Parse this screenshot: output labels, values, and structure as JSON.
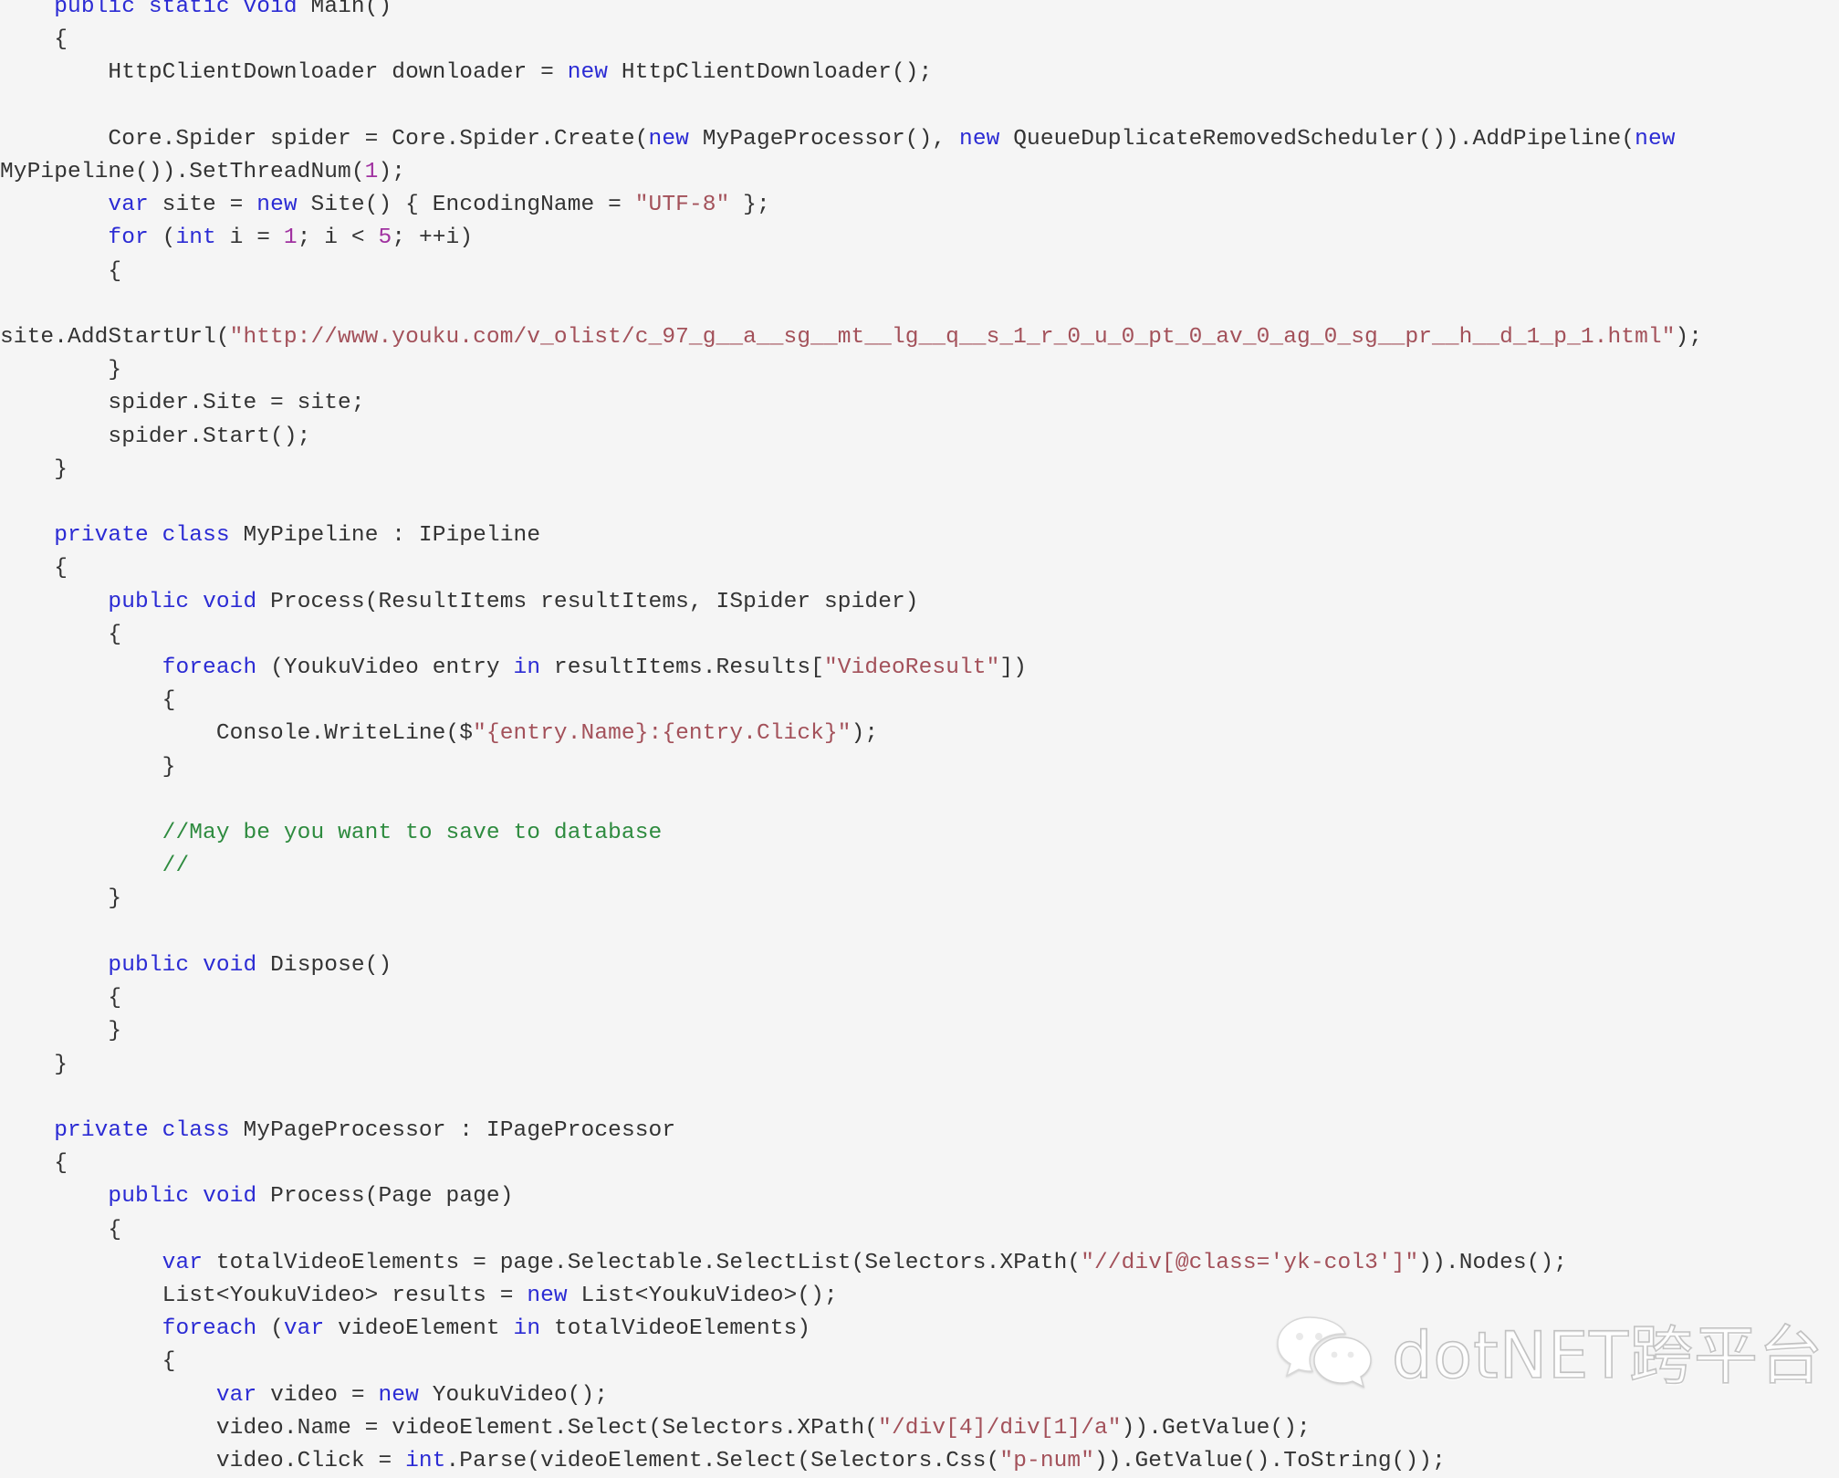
{
  "page": {
    "kind": "code-snippet-image",
    "language": "csharp",
    "background_color": "#f5f5f5",
    "text_color": "#333333",
    "keyword_color": "#2b2bd4",
    "string_color": "#a3515a",
    "number_color": "#a031a0",
    "comment_color": "#2e8b3f"
  },
  "code": {
    "lines": [
      {
        "indent": 1,
        "tokens": [
          {
            "t": "kw",
            "v": "public"
          },
          {
            "t": "pln",
            "v": " "
          },
          {
            "t": "kw",
            "v": "static"
          },
          {
            "t": "pln",
            "v": " "
          },
          {
            "t": "kw",
            "v": "void"
          },
          {
            "t": "pln",
            "v": " Main()"
          }
        ]
      },
      {
        "indent": 1,
        "tokens": [
          {
            "t": "pln",
            "v": "{"
          }
        ]
      },
      {
        "indent": 2,
        "tokens": [
          {
            "t": "pln",
            "v": "HttpClientDownloader downloader = "
          },
          {
            "t": "kw",
            "v": "new"
          },
          {
            "t": "pln",
            "v": " HttpClientDownloader();"
          }
        ]
      },
      {
        "indent": 0,
        "tokens": [
          {
            "t": "pln",
            "v": ""
          }
        ]
      },
      {
        "indent": 2,
        "tokens": [
          {
            "t": "pln",
            "v": "Core.Spider spider = Core.Spider.Create("
          },
          {
            "t": "kw",
            "v": "new"
          },
          {
            "t": "pln",
            "v": " MyPageProcessor(), "
          },
          {
            "t": "kw",
            "v": "new"
          },
          {
            "t": "pln",
            "v": " QueueDuplicateRemovedScheduler()).AddPipeline("
          },
          {
            "t": "kw",
            "v": "new"
          },
          {
            "t": "pln",
            "v": " MyPipeline()).SetThreadNum("
          },
          {
            "t": "num",
            "v": "1"
          },
          {
            "t": "pln",
            "v": ");"
          }
        ]
      },
      {
        "indent": 2,
        "tokens": [
          {
            "t": "kw",
            "v": "var"
          },
          {
            "t": "pln",
            "v": " site = "
          },
          {
            "t": "kw",
            "v": "new"
          },
          {
            "t": "pln",
            "v": " Site() { EncodingName = "
          },
          {
            "t": "str",
            "v": "\"UTF-8\""
          },
          {
            "t": "pln",
            "v": " };"
          }
        ]
      },
      {
        "indent": 2,
        "tokens": [
          {
            "t": "kw",
            "v": "for"
          },
          {
            "t": "pln",
            "v": " ("
          },
          {
            "t": "kw",
            "v": "int"
          },
          {
            "t": "pln",
            "v": " i = "
          },
          {
            "t": "num",
            "v": "1"
          },
          {
            "t": "pln",
            "v": "; i < "
          },
          {
            "t": "num",
            "v": "5"
          },
          {
            "t": "pln",
            "v": "; ++i)"
          }
        ]
      },
      {
        "indent": 2,
        "tokens": [
          {
            "t": "pln",
            "v": "{"
          }
        ]
      },
      {
        "indent": 3,
        "tokens": [
          {
            "t": "pln",
            "v": "site.AddStartUrl("
          },
          {
            "t": "str",
            "v": "\"http://www.youku.com/v_olist/c_97_g__a__sg__mt__lg__q__s_1_r_0_u_0_pt_0_av_0_ag_0_sg__pr__h__d_1_p_1.html\""
          },
          {
            "t": "pln",
            "v": ");"
          }
        ]
      },
      {
        "indent": 2,
        "tokens": [
          {
            "t": "pln",
            "v": "}"
          }
        ]
      },
      {
        "indent": 2,
        "tokens": [
          {
            "t": "pln",
            "v": "spider.Site = site;"
          }
        ]
      },
      {
        "indent": 2,
        "tokens": [
          {
            "t": "pln",
            "v": "spider.Start();"
          }
        ]
      },
      {
        "indent": 1,
        "tokens": [
          {
            "t": "pln",
            "v": "}"
          }
        ]
      },
      {
        "indent": 0,
        "tokens": [
          {
            "t": "pln",
            "v": ""
          }
        ]
      },
      {
        "indent": 1,
        "tokens": [
          {
            "t": "kw",
            "v": "private"
          },
          {
            "t": "pln",
            "v": " "
          },
          {
            "t": "kw",
            "v": "class"
          },
          {
            "t": "pln",
            "v": " MyPipeline : IPipeline"
          }
        ]
      },
      {
        "indent": 1,
        "tokens": [
          {
            "t": "pln",
            "v": "{"
          }
        ]
      },
      {
        "indent": 2,
        "tokens": [
          {
            "t": "kw",
            "v": "public"
          },
          {
            "t": "pln",
            "v": " "
          },
          {
            "t": "kw",
            "v": "void"
          },
          {
            "t": "pln",
            "v": " Process(ResultItems resultItems, ISpider spider)"
          }
        ]
      },
      {
        "indent": 2,
        "tokens": [
          {
            "t": "pln",
            "v": "{"
          }
        ]
      },
      {
        "indent": 3,
        "tokens": [
          {
            "t": "kw",
            "v": "foreach"
          },
          {
            "t": "pln",
            "v": " (YoukuVideo entry "
          },
          {
            "t": "kw",
            "v": "in"
          },
          {
            "t": "pln",
            "v": " resultItems.Results["
          },
          {
            "t": "str",
            "v": "\"VideoResult\""
          },
          {
            "t": "pln",
            "v": "])"
          }
        ]
      },
      {
        "indent": 3,
        "tokens": [
          {
            "t": "pln",
            "v": "{"
          }
        ]
      },
      {
        "indent": 4,
        "tokens": [
          {
            "t": "pln",
            "v": "Console.WriteLine($"
          },
          {
            "t": "str",
            "v": "\"{entry.Name}:{entry.Click}\""
          },
          {
            "t": "pln",
            "v": ");"
          }
        ]
      },
      {
        "indent": 3,
        "tokens": [
          {
            "t": "pln",
            "v": "}"
          }
        ]
      },
      {
        "indent": 0,
        "tokens": [
          {
            "t": "pln",
            "v": ""
          }
        ]
      },
      {
        "indent": 3,
        "tokens": [
          {
            "t": "cmt",
            "v": "//May be you want to save to database"
          }
        ]
      },
      {
        "indent": 3,
        "tokens": [
          {
            "t": "cmt",
            "v": "//"
          }
        ]
      },
      {
        "indent": 2,
        "tokens": [
          {
            "t": "pln",
            "v": "}"
          }
        ]
      },
      {
        "indent": 0,
        "tokens": [
          {
            "t": "pln",
            "v": ""
          }
        ]
      },
      {
        "indent": 2,
        "tokens": [
          {
            "t": "kw",
            "v": "public"
          },
          {
            "t": "pln",
            "v": " "
          },
          {
            "t": "kw",
            "v": "void"
          },
          {
            "t": "pln",
            "v": " Dispose()"
          }
        ]
      },
      {
        "indent": 2,
        "tokens": [
          {
            "t": "pln",
            "v": "{"
          }
        ]
      },
      {
        "indent": 2,
        "tokens": [
          {
            "t": "pln",
            "v": "}"
          }
        ]
      },
      {
        "indent": 1,
        "tokens": [
          {
            "t": "pln",
            "v": "}"
          }
        ]
      },
      {
        "indent": 0,
        "tokens": [
          {
            "t": "pln",
            "v": ""
          }
        ]
      },
      {
        "indent": 1,
        "tokens": [
          {
            "t": "kw",
            "v": "private"
          },
          {
            "t": "pln",
            "v": " "
          },
          {
            "t": "kw",
            "v": "class"
          },
          {
            "t": "pln",
            "v": " MyPageProcessor : IPageProcessor"
          }
        ]
      },
      {
        "indent": 1,
        "tokens": [
          {
            "t": "pln",
            "v": "{"
          }
        ]
      },
      {
        "indent": 2,
        "tokens": [
          {
            "t": "kw",
            "v": "public"
          },
          {
            "t": "pln",
            "v": " "
          },
          {
            "t": "kw",
            "v": "void"
          },
          {
            "t": "pln",
            "v": " Process(Page page)"
          }
        ]
      },
      {
        "indent": 2,
        "tokens": [
          {
            "t": "pln",
            "v": "{"
          }
        ]
      },
      {
        "indent": 3,
        "tokens": [
          {
            "t": "kw",
            "v": "var"
          },
          {
            "t": "pln",
            "v": " totalVideoElements = page.Selectable.SelectList(Selectors.XPath("
          },
          {
            "t": "str",
            "v": "\"//div[@class='yk-col3']\""
          },
          {
            "t": "pln",
            "v": ")).Nodes();"
          }
        ]
      },
      {
        "indent": 3,
        "tokens": [
          {
            "t": "pln",
            "v": "List<YoukuVideo> results = "
          },
          {
            "t": "kw",
            "v": "new"
          },
          {
            "t": "pln",
            "v": " List<YoukuVideo>();"
          }
        ]
      },
      {
        "indent": 3,
        "tokens": [
          {
            "t": "kw",
            "v": "foreach"
          },
          {
            "t": "pln",
            "v": " ("
          },
          {
            "t": "kw",
            "v": "var"
          },
          {
            "t": "pln",
            "v": " videoElement "
          },
          {
            "t": "kw",
            "v": "in"
          },
          {
            "t": "pln",
            "v": " totalVideoElements)"
          }
        ]
      },
      {
        "indent": 3,
        "tokens": [
          {
            "t": "pln",
            "v": "{"
          }
        ]
      },
      {
        "indent": 4,
        "tokens": [
          {
            "t": "kw",
            "v": "var"
          },
          {
            "t": "pln",
            "v": " video = "
          },
          {
            "t": "kw",
            "v": "new"
          },
          {
            "t": "pln",
            "v": " YoukuVideo();"
          }
        ]
      },
      {
        "indent": 4,
        "tokens": [
          {
            "t": "pln",
            "v": "video.Name = videoElement.Select(Selectors.XPath("
          },
          {
            "t": "str",
            "v": "\"/div[4]/div[1]/a\""
          },
          {
            "t": "pln",
            "v": ")).GetValue();"
          }
        ]
      },
      {
        "indent": 4,
        "tokens": [
          {
            "t": "pln",
            "v": "video.Click = "
          },
          {
            "t": "kw",
            "v": "int"
          },
          {
            "t": "pln",
            "v": ".Parse(videoElement.Select(Selectors.Css("
          },
          {
            "t": "str",
            "v": "\"p-num\""
          },
          {
            "t": "pln",
            "v": ")).GetValue().ToString());"
          }
        ]
      }
    ]
  },
  "watermark": {
    "label": "dotNET跨平台",
    "logo_name": "wechat-logo"
  }
}
